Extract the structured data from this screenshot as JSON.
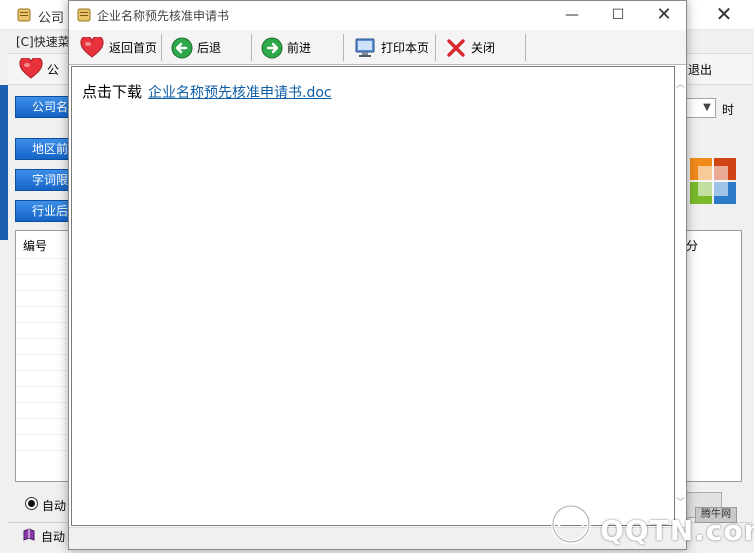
{
  "background_window": {
    "title": "公司",
    "menu_label": "[C]快速菜",
    "toolbar_label": "公",
    "exit_label": "退出",
    "buttons": [
      "公司名",
      "地区前",
      "字词限",
      "行业后"
    ],
    "grid_header": "编号",
    "right_grid_header": "分",
    "time_label": "时",
    "radio_label": "自动",
    "status_label": "自动"
  },
  "popup": {
    "title": "企业名称预先核准申请书",
    "toolbar": {
      "home": "返回首页",
      "back": "后退",
      "forward": "前进",
      "print": "打印本页",
      "close": "关闭"
    },
    "content": {
      "download_prefix": "点击下载",
      "download_link": "企业名称预先核准申请书.doc"
    }
  },
  "watermark": {
    "text": "QQTN.com",
    "badge": "腾牛网"
  },
  "colors": {
    "link": "#0e5fa8",
    "blue_button": "#1565c8",
    "heart": "#e8323c",
    "nav_green": "#2fa84a",
    "close_red": "#d9252f"
  }
}
